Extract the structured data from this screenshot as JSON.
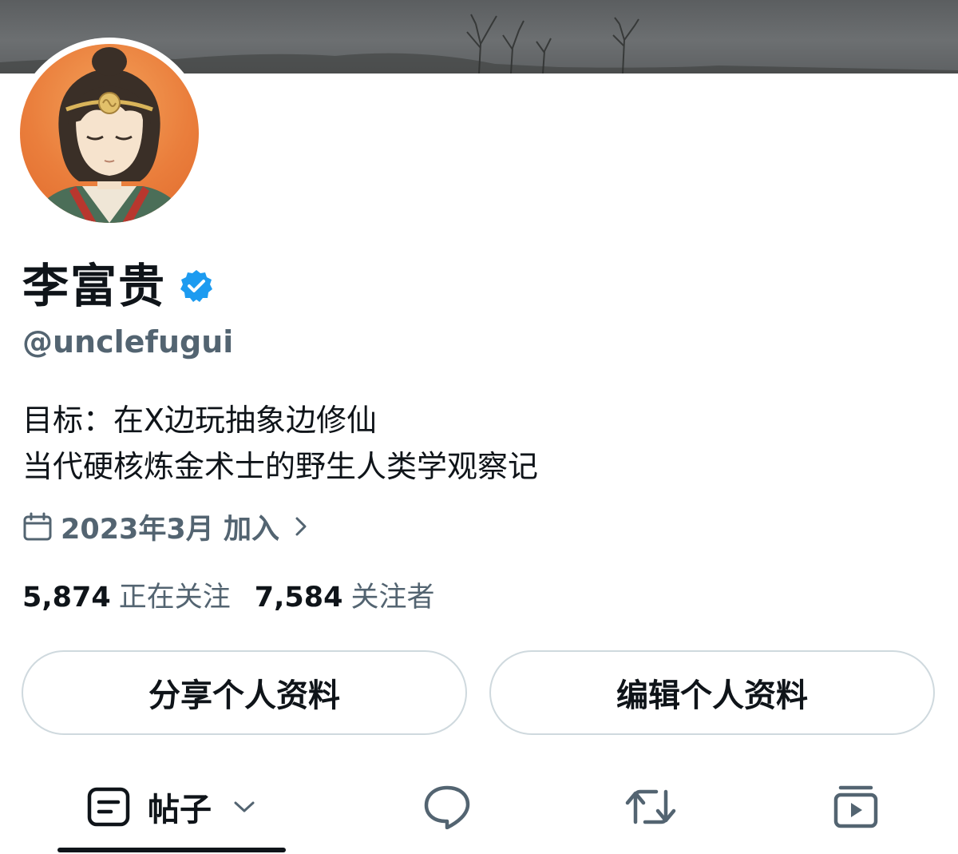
{
  "profile": {
    "display_name": "李富贵",
    "handle": "@unclefugui",
    "verified": true,
    "bio_lines": [
      "目标：在X边玩抽象边修仙",
      "当代硬核炼金术士的野生人类学观察记"
    ],
    "joined": "2023年3月 加入",
    "following_count": "5,874",
    "following_label": "正在关注",
    "followers_count": "7,584",
    "followers_label": "关注者"
  },
  "actions": {
    "share_label": "分享个人资料",
    "edit_label": "编辑个人资料"
  },
  "tabs": {
    "posts_label": "帖子"
  },
  "colors": {
    "verified_blue": "#1d9bf0",
    "secondary_text": "#536471",
    "primary_text": "#0f1419",
    "button_border": "#cfd9de"
  },
  "icons": {
    "verified": "verified-badge-icon",
    "joined": "calendar-icon",
    "joined_chevron": "chevron-right-icon",
    "posts_tab": "posts-icon",
    "posts_dropdown": "chevron-down-icon",
    "replies_tab": "reply-bubble-icon",
    "reposts_tab": "repost-icon",
    "media_tab": "video-icon"
  }
}
